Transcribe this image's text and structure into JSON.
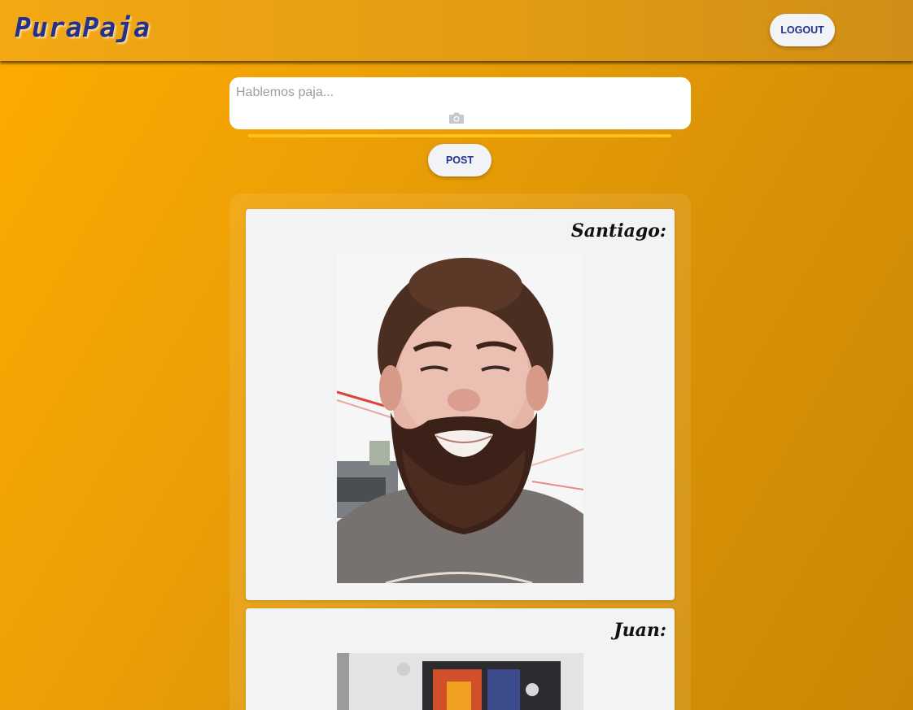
{
  "header": {
    "logo": "PuraPaja",
    "logout_label": "LOGOUT"
  },
  "composer": {
    "placeholder": "Hablemos paja...",
    "value": "",
    "camera_icon": "camera-icon",
    "post_label": "POST"
  },
  "feed": {
    "posts": [
      {
        "author": "Santiago:",
        "image": "bearded-man-selfie"
      },
      {
        "author": "Juan:",
        "image": "room-with-painting"
      }
    ]
  },
  "colors": {
    "background": "#ffab00",
    "header": "#e09b14",
    "logo": "#23318d",
    "button_bg": "#f1f3f6",
    "button_text": "#23318d",
    "card_bg": "#f2f3f5",
    "divider": "#ffc21a"
  }
}
